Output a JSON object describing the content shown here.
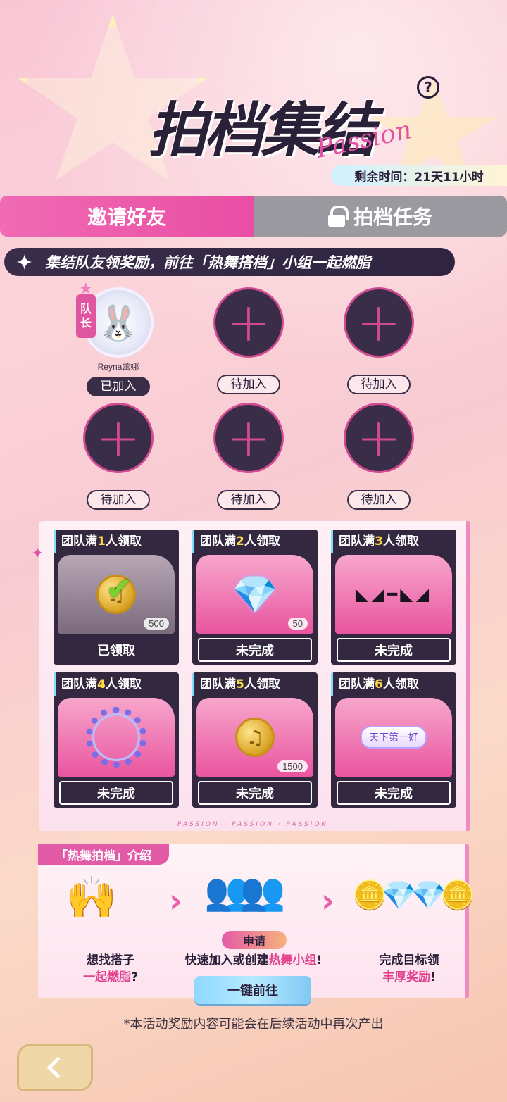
{
  "header": {
    "title": "拍档集结",
    "title_script": "Passion",
    "time_remaining": "剩余时间：21天11小时",
    "help_symbol": "?"
  },
  "tabs": [
    {
      "label": "邀请好友",
      "active": true
    },
    {
      "label": "拍档任务",
      "locked": true,
      "icon": "lock-icon"
    }
  ],
  "banner": {
    "text": "集结队友领奖励，前往「热舞搭档」小组一起燃脂"
  },
  "members": [
    {
      "name": "Reyna蕾娜",
      "status": "已加入",
      "leader_tag": "队长"
    },
    {
      "status": "待加入"
    },
    {
      "status": "待加入"
    },
    {
      "status": "待加入"
    },
    {
      "status": "待加入"
    },
    {
      "status": "待加入"
    }
  ],
  "rewards": [
    {
      "prefix": "团队满",
      "count": "1",
      "suffix": "人领取",
      "quantity": "500",
      "button": "已领取",
      "icon": "music-coin-icon"
    },
    {
      "prefix": "团队满",
      "count": "2",
      "suffix": "人领取",
      "quantity": "50",
      "button": "未完成",
      "icon": "diamond-icon"
    },
    {
      "prefix": "团队满",
      "count": "3",
      "suffix": "人领取",
      "quantity": "",
      "button": "未完成",
      "icon": "sunglasses-icon"
    },
    {
      "prefix": "团队满",
      "count": "4",
      "suffix": "人领取",
      "quantity": "",
      "button": "未完成",
      "icon": "wreath-frame-icon"
    },
    {
      "prefix": "团队满",
      "count": "5",
      "suffix": "人领取",
      "quantity": "1500",
      "button": "未完成",
      "icon": "music-coin-icon"
    },
    {
      "prefix": "团队满",
      "count": "6",
      "suffix": "人领取",
      "quantity": "",
      "button": "未完成",
      "icon": "nameplate-icon",
      "nameplate_text": "天下第一好"
    }
  ],
  "passion_strip": "PASSION · PASSION · PASSION",
  "intro": {
    "tag": "「热舞拍档」介绍",
    "step1_line1": "想找搭子",
    "step1_line2_hl": "一起燃脂",
    "step1_line2_tail": "?",
    "apply_label": "申请",
    "step2_head": "快速加入或创建",
    "step2_hl": "热舞小组",
    "step2_tail": "!",
    "step3_line1": "完成目标领",
    "step3_line2_hl": "丰厚奖励",
    "step3_line2_tail": "!",
    "go_button": "一键前往"
  },
  "footnote": "*本活动奖励内容可能会在后续活动中再次产出",
  "colors": {
    "accent": "#e94ea4",
    "dark": "#33283f",
    "locked": "#9a9aa0"
  }
}
